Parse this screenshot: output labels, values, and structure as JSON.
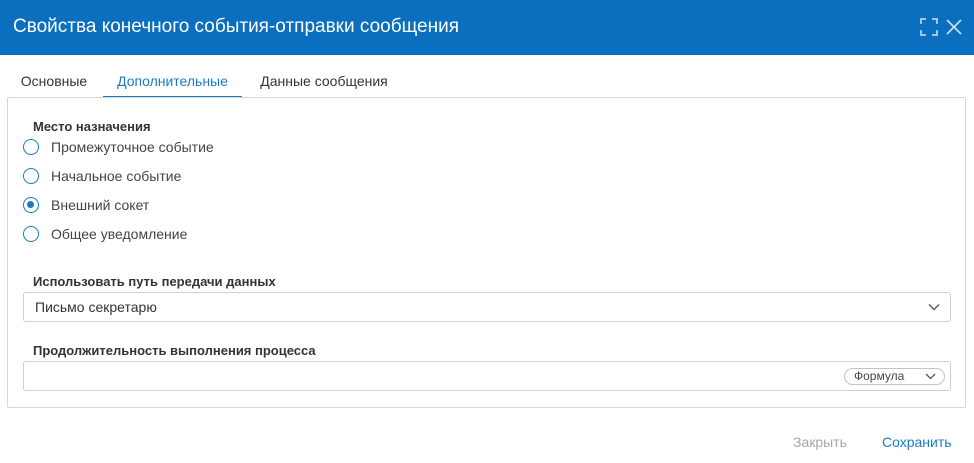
{
  "colors": {
    "titlebar_bg": "#0a6fbe",
    "accent": "#1a7bc4",
    "disabled_text": "#a8a8a8"
  },
  "dialog": {
    "title": "Свойства конечного события-отправки сообщения",
    "maximize_icon": "maximize-icon",
    "close_icon": "close-icon"
  },
  "tabs": [
    {
      "label": "Основные",
      "active": false
    },
    {
      "label": "Дополнительные",
      "active": true
    },
    {
      "label": "Данные сообщения",
      "active": false
    }
  ],
  "destination": {
    "label": "Место назначения",
    "options": [
      {
        "label": "Промежуточное событие",
        "checked": false
      },
      {
        "label": "Начальное событие",
        "checked": false
      },
      {
        "label": "Внешний сокет",
        "checked": true
      },
      {
        "label": "Общее уведомление",
        "checked": false
      }
    ]
  },
  "data_path": {
    "label": "Использовать путь передачи данных",
    "selected": "Письмо секретарю"
  },
  "duration": {
    "label": "Продолжительность выполнения процесса",
    "value": "",
    "mode_button": "Формула"
  },
  "footer": {
    "close_label": "Закрыть",
    "save_label": "Сохранить"
  }
}
